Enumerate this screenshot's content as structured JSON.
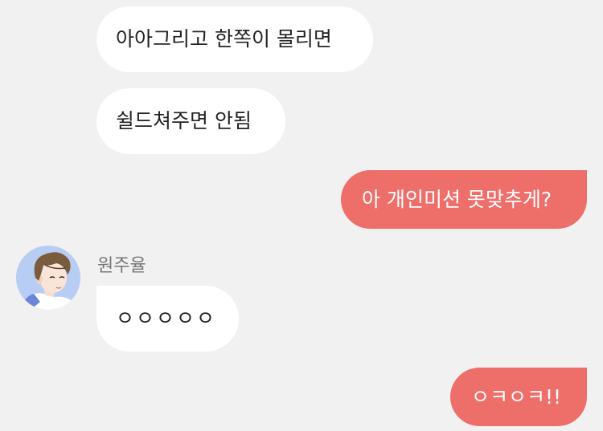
{
  "chat": {
    "messages": [
      {
        "side": "in",
        "text": "아아그리고 한쪽이 몰리면"
      },
      {
        "side": "in",
        "text": "쉴드쳐주면 안됨"
      },
      {
        "side": "out",
        "text": "아 개인미션 못맞추게?"
      },
      {
        "side": "in",
        "sender": "원주율",
        "text": "ㅇㅇㅇㅇㅇ"
      },
      {
        "side": "out",
        "text": "ㅇㅋㅇㅋ!!"
      }
    ]
  },
  "colors": {
    "background": "#f1f1f1",
    "incoming_bubble": "#ffffff",
    "outgoing_bubble": "#ee6e6a",
    "sender_name": "#777777"
  },
  "icons": {
    "avatar": "boy-avatar-icon"
  }
}
